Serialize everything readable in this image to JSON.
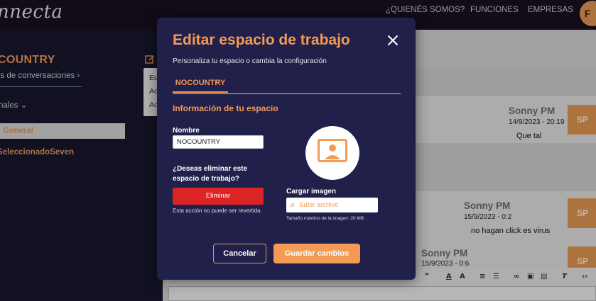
{
  "app": {
    "logo_text": "nnecta",
    "nav": [
      "¿QUIENÉS SOMOS?",
      "FUNCIONES",
      "EMPRESAS"
    ],
    "user_initial": "F",
    "accent_color": "#f39a55"
  },
  "sidebar": {
    "workspace_title": "COUNTRY",
    "conversations_link": "os de conversaciones ›",
    "channels_label": "nales ⌄",
    "active_channel": "General",
    "selected_item": "SeleccionadoSeven",
    "context_menu": [
      "Ed",
      "Ac",
      "Ac"
    ]
  },
  "chat": {
    "messages": [
      {
        "name": "Sonny PM",
        "time": "14/9/2023 - 20:19",
        "text": "Que tal",
        "avatar": "SP"
      },
      {
        "name": "Sonny PM",
        "time": "15/9/2023 - 0:2",
        "text": "no hagan click es virus",
        "avatar": "SP"
      },
      {
        "name": "Sonny PM",
        "time": "15/9/2023 - 0:6",
        "text": "",
        "avatar": "SP"
      }
    ],
    "toolbar_icons": [
      "quote-icon",
      "font-color-icon",
      "highlight-icon",
      "ordered-list-icon",
      "bullet-list-icon",
      "link-icon",
      "image-icon",
      "video-icon",
      "clear-format-icon",
      "code-icon"
    ],
    "toolbar_glyphs": [
      "❞",
      "A",
      "A",
      "≡",
      "☰",
      "∞",
      "▣",
      "▤",
      "T",
      "‹›"
    ]
  },
  "modal": {
    "title": "Editar espacio de trabajo",
    "subtitle": "Personaliza tu espacio o cambia la configuración",
    "tab": "NOCOUNTRY",
    "section_title": "Información de tu espacio",
    "name_label": "Nombre",
    "name_value": "NOCOUNTRY",
    "delete_question": "¿Deseas eliminar este espacio de trabajo?",
    "delete_button": "Eliminar",
    "delete_warning": "Esta acción no puede ser revertida.",
    "image_label": "Cargar imagen",
    "upload_button": "Subir archivo",
    "max_size": "Tamaño máximo de la imagen: 20 MB",
    "cancel_button": "Cancelar",
    "save_button": "Guardar cambios"
  }
}
